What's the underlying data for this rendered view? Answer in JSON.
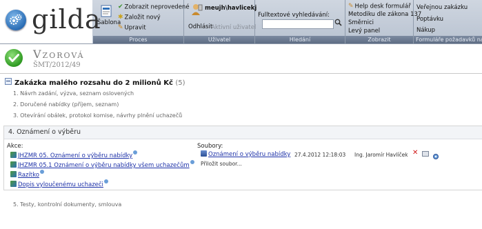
{
  "logo": {
    "text": "gilda"
  },
  "ribbon": {
    "proces": {
      "footer": "Proces",
      "sablona": "Šablona",
      "zobrazit": "Zobrazit neprovedené",
      "zalozit": "Založit nový",
      "upravit": "Upravit"
    },
    "uzivatel": {
      "footer": "Uživatel",
      "name": "meujh\\havlicekj",
      "odhlasit": "Odhlásit",
      "aktivni": "Aktivní uživatel"
    },
    "hledani": {
      "footer": "Hledání",
      "label": "Fulltextové vyhledávání:",
      "value": ""
    },
    "zobrazit": {
      "footer": "Zobrazit",
      "items": [
        "Help desk formulář",
        "Metodiku dle zákona 137",
        "Směrnici",
        "Levý panel"
      ]
    },
    "formulare": {
      "footer": "Formuláře požadavků na",
      "items": [
        "Veřejnou zakázku",
        "Poptávku",
        "Nákup"
      ]
    }
  },
  "header": {
    "title": "Vzorová",
    "subtitle": "ŠMT/2012/49"
  },
  "section": {
    "title": "Zakázka malého rozsahu do 2 milionů Kč",
    "count": "(5)",
    "steps": [
      "1. Návrh zadání, výzva, seznam oslovených",
      "2. Doručené nabídky (příjem, seznam)",
      "3. Otevírání obálek, protokol komise, návrhy plnění uchazečů"
    ],
    "active_step": {
      "title": "4. Oznámení o výběru",
      "akce_label": "Akce:",
      "akce": [
        "JHZMR 05. Oznámení o výběru nabídky",
        "JHZMR 05.1 Oznámení o výběru nabídky všem uchazečům",
        "Razítko",
        "Dopis vyloučenému uchazeči"
      ],
      "soubory_label": "Soubory:",
      "file": {
        "name": "Oznámení o výběru nabídky",
        "date": "27.4.2012 12:18:03",
        "author": "Ing. Jaromír Havlíček"
      },
      "attach": "Přiložit soubor..."
    },
    "last_step": "5. Testy, kontrolní dokumenty, smlouva"
  }
}
